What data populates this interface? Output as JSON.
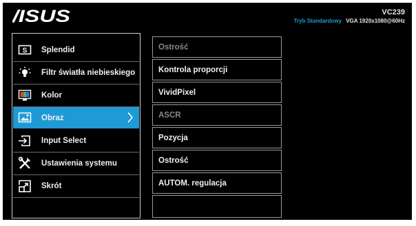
{
  "header": {
    "brand": "ASUS",
    "model": "VC239",
    "mode": "Tryb Standardowy",
    "signal": "VGA  1920x1080@60Hz"
  },
  "menu": {
    "items": [
      {
        "label": "Splendid",
        "icon": "splendid-icon"
      },
      {
        "label": "Filtr światła niebieskiego",
        "icon": "bulb-icon"
      },
      {
        "label": "Kolor",
        "icon": "color-icon"
      },
      {
        "label": "Obraz",
        "icon": "image-icon",
        "selected": true
      },
      {
        "label": "Input Select",
        "icon": "input-icon"
      },
      {
        "label": "Ustawienia systemu",
        "icon": "tools-icon"
      },
      {
        "label": "Skrót",
        "icon": "shortcut-icon"
      }
    ]
  },
  "submenu": {
    "items": [
      {
        "label": "Ostrość",
        "enabled": false
      },
      {
        "label": "Kontrola proporcji",
        "enabled": true
      },
      {
        "label": "VividPixel",
        "enabled": true
      },
      {
        "label": "ASCR",
        "enabled": false
      },
      {
        "label": "Pozycja",
        "enabled": true
      },
      {
        "label": "Ostrość",
        "enabled": true
      },
      {
        "label": "AUTOM. regulacja",
        "enabled": true
      },
      {
        "label": "",
        "enabled": true
      }
    ]
  },
  "colors": {
    "accent": "#1e9ad6",
    "background": "#000000",
    "text": "#f0f0f0",
    "disabled": "#8a8a8a"
  }
}
